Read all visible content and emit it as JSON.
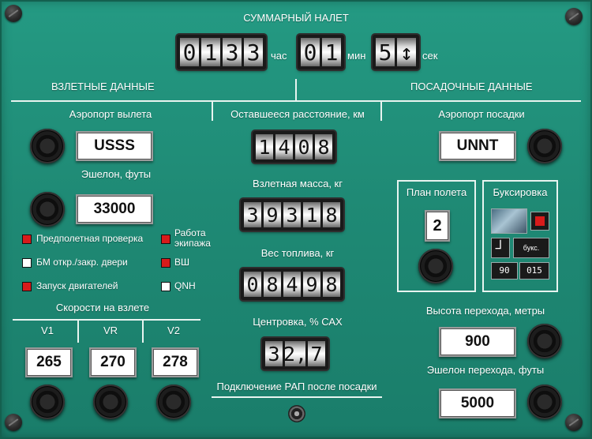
{
  "total_flight_time": {
    "title": "СУММАРНЫЙ НАЛЕТ",
    "hours": [
      "0",
      "1",
      "3",
      "3"
    ],
    "hours_unit": "час",
    "minutes": [
      "0",
      "1"
    ],
    "minutes_unit": "мин",
    "seconds": [
      "5",
      "↕"
    ],
    "seconds_unit": "сек"
  },
  "departure": {
    "section_title": "ВЗЛЕТНЫЕ ДАННЫЕ",
    "airport_label": "Аэропорт вылета",
    "airport": "USSS",
    "flight_level_label": "Эшелон, футы",
    "flight_level": "33000",
    "indicators": [
      {
        "label": "Предполетная проверка",
        "color": "red"
      },
      {
        "label": "БМ откр./закр. двери",
        "color": "white"
      },
      {
        "label": "Запуск двигателей",
        "color": "red"
      },
      {
        "label": "Работа экипажа",
        "color": "red"
      },
      {
        "label": "ВШ",
        "color": "red"
      },
      {
        "label": "QNH",
        "color": "white"
      }
    ],
    "speeds_label": "Скорости на взлете",
    "v1_label": "V1",
    "vr_label": "VR",
    "v2_label": "V2",
    "v1": "265",
    "vr": "270",
    "v2": "278"
  },
  "center": {
    "remaining_distance_label": "Оставшееся расстояние, км",
    "remaining_distance": [
      "1",
      "4",
      "0",
      "8"
    ],
    "takeoff_mass_label": "Взлетная масса, кг",
    "takeoff_mass": [
      "3",
      "9",
      "3",
      "1",
      "8"
    ],
    "fuel_weight_label": "Вес топлива, кг",
    "fuel_weight": [
      "0",
      "8",
      "4",
      "9",
      "8"
    ],
    "cg_label": "Центровка, % САХ",
    "cg": [
      "3",
      "2,",
      "7"
    ],
    "gpu_label": "Подключение РАП после посадки"
  },
  "arrival": {
    "section_title": "ПОСАДОЧНЫЕ ДАННЫЕ",
    "airport_label": "Аэропорт посадки",
    "airport": "UNNT",
    "flight_plan_label": "План полета",
    "flight_plan_value": "2",
    "towing_label": "Буксировка",
    "towing_small_label": "букс.",
    "towing_values": [
      "90",
      "015"
    ],
    "transition_altitude_label": "Высота перехода, метры",
    "transition_altitude": "900",
    "transition_level_label": "Эшелон перехода, футы",
    "transition_level": "5000"
  },
  "colors": {
    "panel": "#1f8a75",
    "indicator_red": "#d81b1b",
    "indicator_white": "#ffffff"
  }
}
